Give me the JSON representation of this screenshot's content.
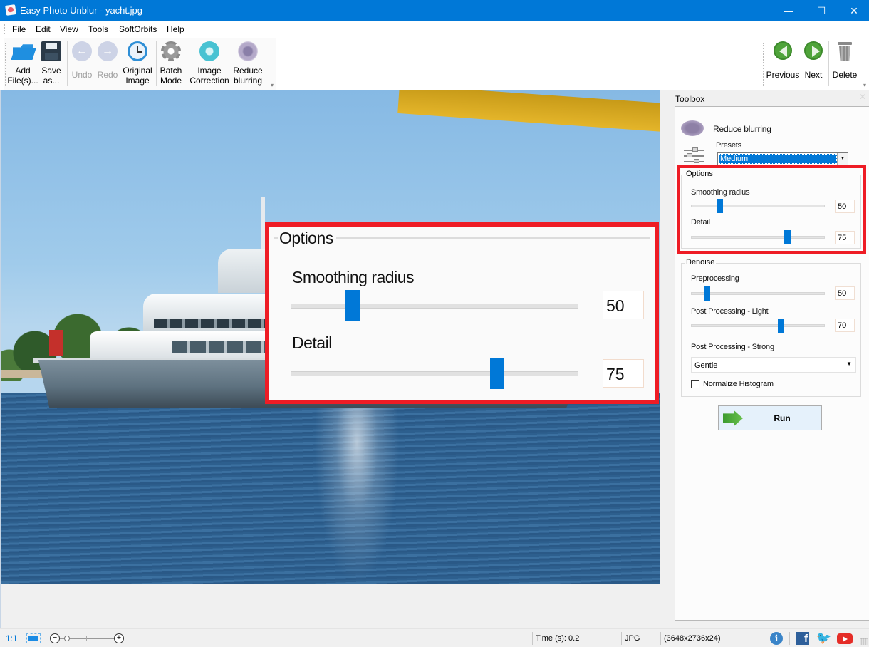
{
  "window": {
    "title": "Easy Photo Unblur - yacht.jpg",
    "controls": {
      "minimize": "—",
      "maximize": "☐",
      "close": "✕"
    }
  },
  "menu": [
    {
      "label": "File",
      "accel": "F",
      "rest": "ile"
    },
    {
      "label": "Edit",
      "accel": "E",
      "rest": "dit"
    },
    {
      "label": "View",
      "accel": "V",
      "rest": "iew"
    },
    {
      "label": "Tools",
      "accel": "T",
      "rest": "ools"
    },
    {
      "label": "SoftOrbits",
      "accel": "",
      "rest": "SoftOrbits"
    },
    {
      "label": "Help",
      "accel": "H",
      "rest": "elp"
    }
  ],
  "toolbar": {
    "add_files": {
      "label": "Add\nFile(s)...",
      "icon": "folder-open-icon"
    },
    "save_as": {
      "label": "Save\nas...",
      "icon": "floppy-disk-icon"
    },
    "undo": {
      "label": "Undo",
      "icon": "undo-arrow-icon",
      "enabled": false
    },
    "redo": {
      "label": "Redo",
      "icon": "redo-arrow-icon",
      "enabled": false
    },
    "original_image": {
      "label": "Original\nImage",
      "icon": "clock-history-icon"
    },
    "batch_mode": {
      "label": "Batch\nMode",
      "icon": "gear-icon"
    },
    "image_correction": {
      "label": "Image\nCorrection",
      "icon": "correction-star-icon"
    },
    "reduce_blurring": {
      "label": "Reduce\nblurring",
      "icon": "blur-icon"
    },
    "previous": {
      "label": "Previous",
      "icon": "arrow-left-circle-icon"
    },
    "next": {
      "label": "Next",
      "icon": "arrow-right-circle-icon"
    },
    "delete": {
      "label": "Delete",
      "icon": "trash-icon"
    }
  },
  "callout": {
    "title": "Options",
    "smoothing_label": "Smoothing radius",
    "smoothing_value": "50",
    "detail_label": "Detail",
    "detail_value": "75",
    "accent": "#ee1c25"
  },
  "toolbox": {
    "title": "Toolbox",
    "close": "✕",
    "tool_name": "Reduce blurring",
    "presets_label": "Presets",
    "presets_value": "Medium",
    "options": {
      "title": "Options",
      "smoothing": {
        "label": "Smoothing radius",
        "value": 50,
        "display": "50",
        "fraction": 0.2
      },
      "detail": {
        "label": "Detail",
        "value": 75,
        "display": "75",
        "fraction": 0.73
      }
    },
    "denoise": {
      "title": "Denoise",
      "preprocessing": {
        "label": "Preprocessing",
        "value": 50,
        "display": "50",
        "fraction": 0.1
      },
      "post_light": {
        "label": "Post Processing - Light",
        "value": 70,
        "display": "70",
        "fraction": 0.68
      },
      "post_strong_label": "Post Processing - Strong",
      "post_strong_value": "Gentle",
      "normalize_label": "Normalize Histogram",
      "normalize_checked": false
    },
    "run_label": "Run"
  },
  "status": {
    "ratio": "1:1",
    "time": "Time (s): 0.2",
    "format": "JPG",
    "dimensions": "(3648x2736x24)",
    "zoom_minus": "−",
    "zoom_plus": "+",
    "info": "i",
    "facebook": "f",
    "twitter": "🐦"
  },
  "colors": {
    "titlebar": "#0078d7",
    "slider_thumb": "#0078d7",
    "highlight_frame": "#ee1c25"
  }
}
